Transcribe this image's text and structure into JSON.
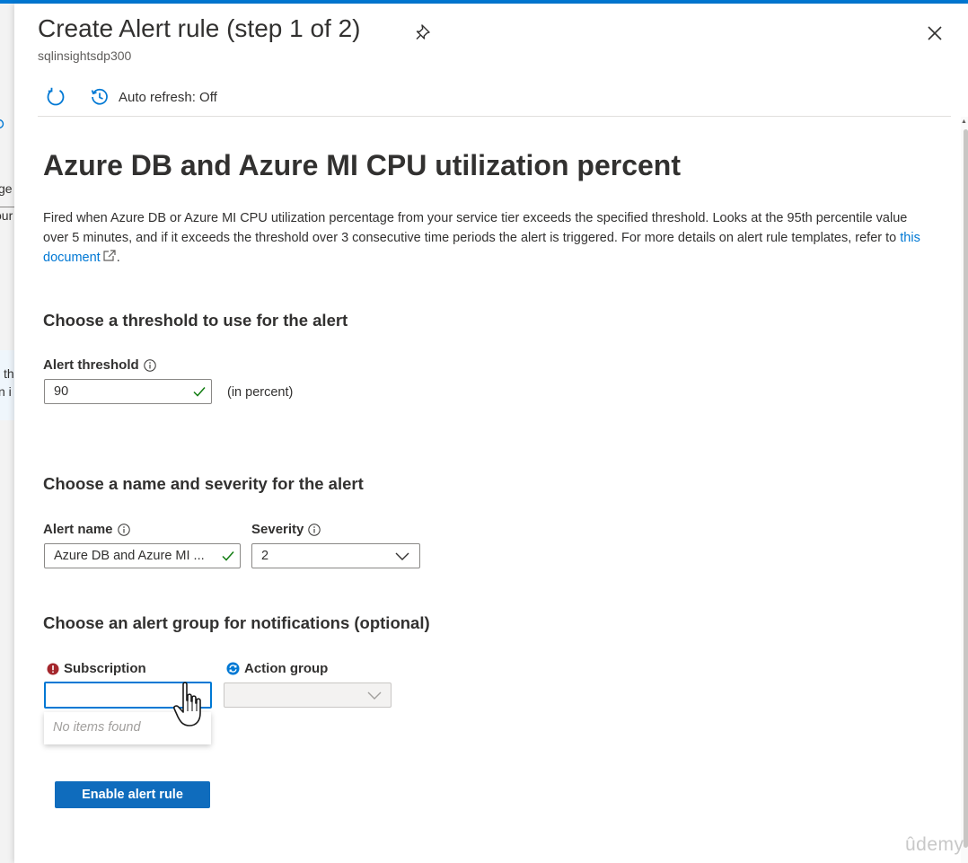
{
  "background_fragments": {
    "line1": "ge",
    "line2": "our",
    "line3": "th",
    "line4": "n i"
  },
  "panel": {
    "title": "Create Alert rule (step 1 of 2)",
    "subtitle": "sqlinsightsdp300",
    "icons": {
      "pin": "pin-icon",
      "close": "close-icon"
    }
  },
  "toolbar": {
    "refresh_icon": "refresh-icon",
    "auto_refresh_label": "Auto refresh: Off",
    "auto_refresh_icon": "history-clock-icon"
  },
  "rule": {
    "heading": "Azure DB and Azure MI CPU utilization percent",
    "description_text": "Fired when Azure DB or Azure MI CPU utilization percentage from your service tier exceeds the specified threshold. Looks at the 95th percentile value over 5 minutes, and if it exceeds the threshold over 3 consecutive time periods the alert is triggered. For more details on alert rule templates, refer to ",
    "description_link": "this document",
    "description_end": "."
  },
  "threshold": {
    "section_title": "Choose a threshold to use for the alert",
    "label": "Alert threshold",
    "value": "90",
    "unit": "(in percent)"
  },
  "name_severity": {
    "section_title": "Choose a name and severity for the alert",
    "name_label": "Alert name",
    "name_value": "Azure DB and Azure MI ...",
    "severity_label": "Severity",
    "severity_value": "2"
  },
  "notifications": {
    "section_title": "Choose an alert group for notifications (optional)",
    "subscription_label": "Subscription",
    "subscription_value": "",
    "dropdown_empty_text": "No items found",
    "action_group_label": "Action group",
    "action_group_value": ""
  },
  "actions": {
    "enable_label": "Enable alert rule"
  },
  "watermark": "ûdemy",
  "colors": {
    "accent": "#0078d4",
    "button": "#0f6cbd",
    "success": "#107c10",
    "error": "#a4262c",
    "text": "#323130"
  }
}
